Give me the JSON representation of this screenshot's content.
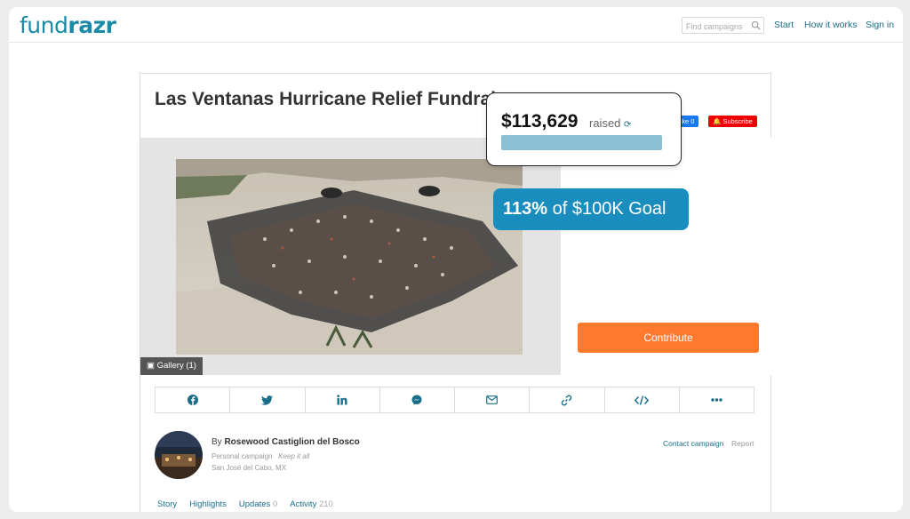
{
  "header": {
    "logo_part1": "fund",
    "logo_part2": "razr",
    "search_placeholder": "Find campaigns",
    "nav": [
      "Start",
      "How it works",
      "Sign in"
    ]
  },
  "campaign": {
    "title": "Las Ventanas Hurricane Relief Fundraiser",
    "like_label": "Like 0",
    "subscribe_label": "Subscribe",
    "gallery_label": "Gallery (1)",
    "amount": "$113,629",
    "raised_label": "raised",
    "progress": 1.0,
    "goal_percent": "113%",
    "goal_text": "of $100K Goal",
    "contribute_label": "Contribute"
  },
  "share_icons": [
    "facebook-icon",
    "twitter-icon",
    "linkedin-icon",
    "messenger-icon",
    "email-icon",
    "link-icon",
    "embed-icon",
    "more-icon"
  ],
  "organizer": {
    "by_prefix": "By",
    "name": "Rosewood Castiglion del Bosco",
    "type": "Personal campaign",
    "keep": "Keep it all",
    "location": "San José del Cabo, MX",
    "contact_label": "Contact campaign",
    "report_label": "Report"
  },
  "tabs": [
    {
      "label": "Story",
      "count": ""
    },
    {
      "label": "Highlights",
      "count": ""
    },
    {
      "label": "Updates",
      "count": "0"
    },
    {
      "label": "Activity",
      "count": "210"
    }
  ],
  "colors": {
    "brand": "#1a8aa6",
    "accent": "#ff7a2e",
    "goal": "#1a8dbf",
    "progress": "#8bbfd2"
  }
}
